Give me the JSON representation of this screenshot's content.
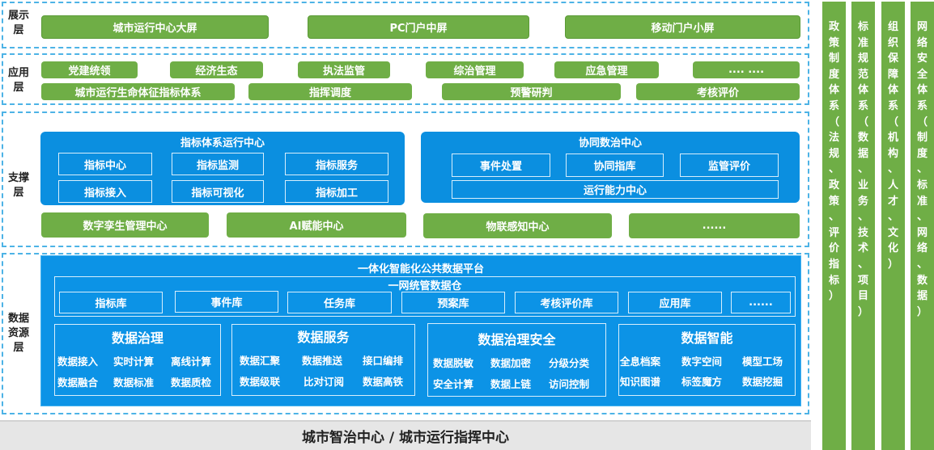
{
  "layers": {
    "display": {
      "title": "展示层",
      "items": [
        "城市运行中心大屏",
        "PC门户中屏",
        "移动门户小屏"
      ]
    },
    "application": {
      "title": "应用层",
      "row1": [
        "党建统领",
        "经济生态",
        "执法监管",
        "综治管理",
        "应急管理",
        ".... ...."
      ],
      "row2": [
        "城市运行生命体征指标体系",
        "指挥调度",
        "预警研判",
        "考核评价"
      ]
    },
    "support": {
      "title": "支撑层",
      "indicator_center": {
        "title": "指标体系运行中心",
        "items": [
          "指标中心",
          "指标监测",
          "指标服务",
          "指标接入",
          "指标可视化",
          "指标加工"
        ]
      },
      "coop_center": {
        "title": "协同数治中心",
        "items": [
          "事件处置",
          "协同指库",
          "监管评价"
        ],
        "wide": "运行能力中心"
      },
      "bottom": [
        "数字孪生管理中心",
        "AI赋能中心",
        "物联感知中心",
        "......"
      ]
    },
    "data": {
      "title": "数据资源层",
      "platform_title": "一体化智能化公共数据平台",
      "warehouse_title": "一网统管数据仓",
      "libs": [
        "指标库",
        "事件库",
        "任务库",
        "预案库",
        "考核评价库",
        "应用库",
        "......"
      ],
      "groups": [
        {
          "title": "数据治理",
          "cells": [
            "数据接入",
            "实时计算",
            "离线计算",
            "数据融合",
            "数据标准",
            "数据质检"
          ]
        },
        {
          "title": "数据服务",
          "cells": [
            "数据汇聚",
            "数据推送",
            "接口编排",
            "数据级联",
            "比对订阅",
            "数据高铁"
          ]
        },
        {
          "title": "数据治理安全",
          "cells": [
            "数据脱敏",
            "数据加密",
            "分级分类",
            "安全计算",
            "数据上链",
            "访问控制"
          ]
        },
        {
          "title": "数据智能",
          "cells": [
            "全息档案",
            "数字空间",
            "模型工场",
            "知识图谱",
            "标签魔方",
            "数据挖掘"
          ]
        }
      ]
    }
  },
  "footer": "城市智治中心 / 城市运行指挥中心",
  "side_columns": [
    "政策制度体系（法规、政策、评价指标）",
    "标准规范体系（数据、业务、技术、项目）",
    "组织保障体系（机构、人才、文化）",
    "网络安全体系（制度、标准、网络、数据）"
  ],
  "colors": {
    "green": "#6fae46",
    "blue": "#0b8fe0",
    "dash": "#4db3e6",
    "footer_bg": "#e6e6e6"
  }
}
